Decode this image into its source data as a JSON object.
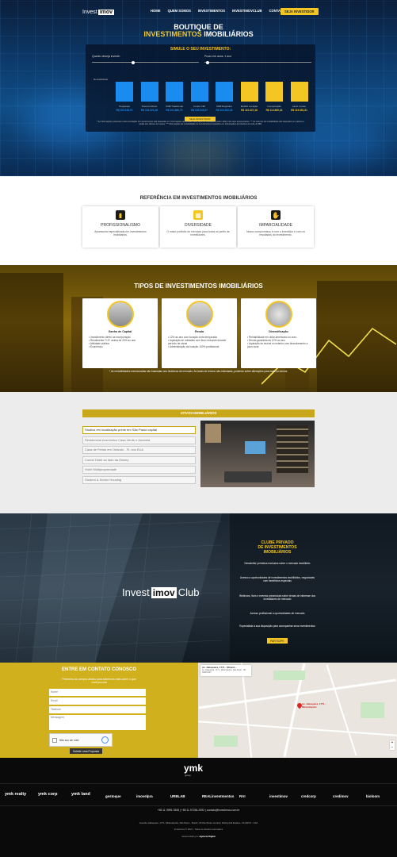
{
  "header": {
    "logo_part1": "Invest",
    "logo_part2": "imov",
    "nav": [
      "HOME",
      "QUEM SOMOS",
      "INVESTIMENTOS",
      "INVESTIMOVCLUB",
      "CONTATO"
    ],
    "cta": "SEJA INVESTIDOR"
  },
  "hero": {
    "title_line1": "BOUTIQUE DE",
    "title_line2_yellow": "INVESTIMENTOS",
    "title_line2_white": "IMOBILIÁRIOS",
    "simulator_title": "SIMULE O SEU INVESTIMENTO:",
    "amount_label": "Quanto deseja investir:",
    "term_label": "Prazo em anos: 1 ano",
    "y_axis_label": "Rentabilidade",
    "bars": [
      {
        "label": "Poupança",
        "value": "R$ 103.128,70",
        "level": 0.78,
        "color": "#1a8cf0"
      },
      {
        "label": "Tesouro Direto",
        "value": "R$ 104.521,48",
        "level": 0.78,
        "color": "#1a8cf0"
      },
      {
        "label": "CDB Tradicional",
        "value": "R$ 104.880,75",
        "level": 0.78,
        "color": "#1a8cf0"
      },
      {
        "label": "Fundo CDI",
        "value": "R$ 105.539,47",
        "level": 0.78,
        "color": "#1a8cf0"
      },
      {
        "label": "CDB Depósitor",
        "value": "R$ 104.302,45",
        "level": 0.78,
        "color": "#1a8cf0"
      },
      {
        "label": "Mobiliz Locação",
        "value": "R$ 110.427,48",
        "level": 0.78,
        "color": "#f3c623"
      },
      {
        "label": "Incorporação",
        "value": "R$ 114.869,34",
        "level": 0.78,
        "color": "#f3c623"
      },
      {
        "label": "Land. Cooter",
        "value": "R$ 119.381,81",
        "level": 0.78,
        "color": "#f3c623"
      }
    ],
    "simulate_button": "SEJA INVESTIDOR",
    "note": "* As informações presentes nesta simulação de investimentos são baseadas em informações que variam dia a dia e os resultados podem diferir dos aqui apresentados. ** Os retornos de rentabilidade são baseados em valores e média dos últimos 12 meses. *** Informações de rentabilidade de investimentos baseados em informações de histórico de rede do IBR."
  },
  "referencia": {
    "title": "REFERÊNCIA EM INVESTIMENTOS IMOBILIÁRIOS",
    "cards": [
      {
        "icon": "briefcase-icon",
        "glyph": "▮",
        "color": "#1a1a1a",
        "title": "PROFISSIONALISMO",
        "text": "Assessoria especializada em investimentos imobiliários."
      },
      {
        "icon": "diversity-icon",
        "glyph": "▦",
        "color": "#f3c623",
        "title": "DIVERSIDADE",
        "text": "O maior portfólio do mercado para todos os perfis de investidores."
      },
      {
        "icon": "handshake-icon",
        "glyph": "✋",
        "color": "#1a1a1a",
        "title": "IMPARCIALIDADE",
        "text": "Nosso compromisso é com o investidor e com os resultados do investimento."
      }
    ]
  },
  "tipos": {
    "title": "TIPOS DE INVESTIMENTOS IMOBILIÁRIOS",
    "cards": [
      {
        "title": "Ganho de Capital",
        "items": [
          "• Investimento direto na incorporação",
          "• Rendimento T.I.R. acima de 20% ao ano",
          "• Atividade pública",
          "• Econômico"
        ]
      },
      {
        "title": "Renda",
        "items": [
          "• 12% ao ano com locação curta temporada",
          "• Aquisição de unidades com fluxo reduzido durante período de obras",
          "• Administração da locação 100% profissional"
        ]
      },
      {
        "title": "Diversificação",
        "items": [
          "• Rentabilidade em dólar americano ou euro",
          "• Renda garantida de 10% ao ano",
          "• Aquisição de imóvel no exterior com financiamento a juros local"
        ]
      }
    ],
    "note": "* As rentabilidades mencionadas são baseadas nos históricos de mercado. As taxas de retorno são estimadas, podendo sofrer alterações para mais ou menos."
  },
  "ativos": {
    "title": "ATIVOS IMOBILIÁRIOS",
    "items": [
      "Studios em localização prime em São Paulo capital",
      "Residencial econômico Casa Verde e Amarela",
      "Casa de Férias em Orlando - FL nos EUA",
      "Condo Hotel ao lado da Disney",
      "Hotel Multipropriedade",
      "Student & Senior Housing"
    ]
  },
  "club": {
    "logo_part1": "Invest",
    "logo_part2": "imov",
    "logo_part3": "Club",
    "title_line1": "CLUBE PRIVADO",
    "title_line2": "DE INVESTIMENTOS",
    "title_line3": "IMOBILIÁRIOS",
    "bullets": [
      "Newsletter periódica exclusiva sobre o mercado imobiliário",
      "Acesso a oportunidades de investimentos imobiliários, negociadas com benefícios especiais",
      "Webinars, lives e eventos presenciais sobre temas de interesse dos investidores de mercado",
      "Acesso profissional a oportunidades de mercado",
      "Especialista à sua disposição para acompanhar seus investimentos"
    ],
    "button": "PARTICIPE"
  },
  "contact": {
    "title": "ENTRE EM CONTATO CONOSCO",
    "subtitle": "Preencha os campos abaixo para sabermos mais sobre o que você procura",
    "placeholders": [
      "Nome",
      "Email",
      "Telefone",
      "Mensagem"
    ],
    "captcha": "Não sou um robô",
    "button": "Solicite uma Proposta",
    "map_address": "Av. Jabaquara, 1771 - Mirand...",
    "map_address_detail": "Av. Jabaquara, 1771 - Mirandópolis, São Paulo - SP, 04045-003",
    "map_pin_label": "Av. Jabaquara, 1771 - Mirandópolis"
  },
  "footer": {
    "group_logo": "ymk",
    "group_sub": "group",
    "brands": [
      "ymk realty",
      "ymk corp",
      "ymk land",
      "gestoque",
      "imovelpra",
      "URBLAB",
      "REALinvestmentos",
      "RAI",
      "investimov",
      "credcorp",
      "credimov",
      "bioloom"
    ],
    "contact_line": "+55 11 3995-7808 | +55 11 97236-2092 | contato@investimov.com.br",
    "address_line": "Avenida Jabaquara, 1771, Mirandópolis, São Paulo - Brasil | 18 Pembroke Central | Rolling Hill Estates, CA 90274 - USA",
    "copyright": "Investimov © 2021 - Todos os direitos reservados",
    "dev_label": "desenvolvido por",
    "dev_agency": "Agência Digital"
  }
}
